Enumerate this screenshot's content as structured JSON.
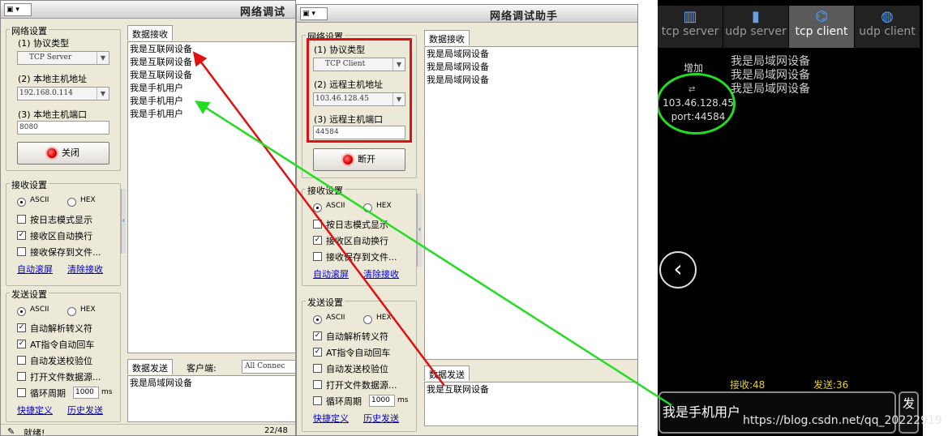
{
  "left_window": {
    "title": "网络调试",
    "net_group": "网络设置",
    "protocol_label": "(1) 协议类型",
    "protocol_value": "TCP Server",
    "local_addr_label": "(2) 本地主机地址",
    "local_addr_value": "192.168.0.114",
    "local_port_label": "(3) 本地主机端口",
    "local_port_value": "8080",
    "close_button": "关闭",
    "recv_group": "接收设置",
    "ascii": "ASCII",
    "hex": "HEX",
    "log_mode": "按日志模式显示",
    "auto_wrap": "接收区自动换行",
    "save_file": "接收保存到文件...",
    "auto_scroll": "自动滚屏",
    "clear_recv": "清除接收",
    "send_group": "发送设置",
    "parse_escape": "自动解析转义符",
    "at_cr": "AT指令自动回车",
    "auto_checksum": "自动发送校验位",
    "open_file": "打开文件数据源...",
    "cycle": "循环周期",
    "cycle_value": "1000",
    "ms": "ms",
    "shortcut": "快捷定义",
    "history": "历史发送",
    "recv_tab": "数据接收",
    "recv_lines": [
      "我是互联网设备",
      "我是互联网设备",
      "我是互联网设备",
      "我是手机用户",
      "我是手机用户",
      "我是手机用户"
    ],
    "send_tab": "数据发送",
    "client_label": "客户端:",
    "client_select": "All Connec",
    "send_text": "我是局域网设备",
    "status_text": "就绪!",
    "counter": "22/48"
  },
  "mid_window": {
    "title": "网络调试助手",
    "net_group": "网络设置",
    "protocol_label": "(1) 协议类型",
    "protocol_value": "TCP Client",
    "remote_addr_label": "(2) 远程主机地址",
    "remote_addr_value": "103.46.128.45",
    "remote_port_label": "(3) 远程主机端口",
    "remote_port_value": "44584",
    "disconnect_button": "断开",
    "recv_group": "接收设置",
    "ascii": "ASCII",
    "hex": "HEX",
    "log_mode": "按日志模式显示",
    "auto_wrap": "接收区自动换行",
    "save_file": "接收保存到文件...",
    "auto_scroll": "自动滚屏",
    "clear_recv": "清除接收",
    "send_group": "发送设置",
    "parse_escape": "自动解析转义符",
    "at_cr": "AT指令自动回车",
    "auto_checksum": "自动发送校验位",
    "open_file": "打开文件数据源...",
    "cycle": "循环周期",
    "cycle_value": "1000",
    "ms": "ms",
    "shortcut": "快捷定义",
    "history": "历史发送",
    "recv_tab": "数据接收",
    "recv_lines": [
      "我是局域网设备",
      "我是局域网设备",
      "我是局域网设备"
    ],
    "send_tab": "数据发送",
    "send_text": "我是互联网设备"
  },
  "phone": {
    "tabs": [
      "tcp server",
      "udp server",
      "tcp client",
      "udp client"
    ],
    "add_label": "增加",
    "remote_ip": "103.46.128.45",
    "remote_port": "port:44584",
    "recv_lines": [
      "我是局域网设备",
      "我是局域网设备",
      "我是局域网设备"
    ],
    "recv_count": "接收:48",
    "send_count": "发送:36",
    "input_text": "我是手机用户",
    "send_button": "发",
    "back_icon": "‹",
    "watermark": "https://blog.csdn.net/qq_20222919"
  },
  "colors": {
    "highlight_red": "#e01010",
    "arrow_green": "#22dd22",
    "arrow_red": "#e01010",
    "phone_yellow": "#e8d21c"
  }
}
